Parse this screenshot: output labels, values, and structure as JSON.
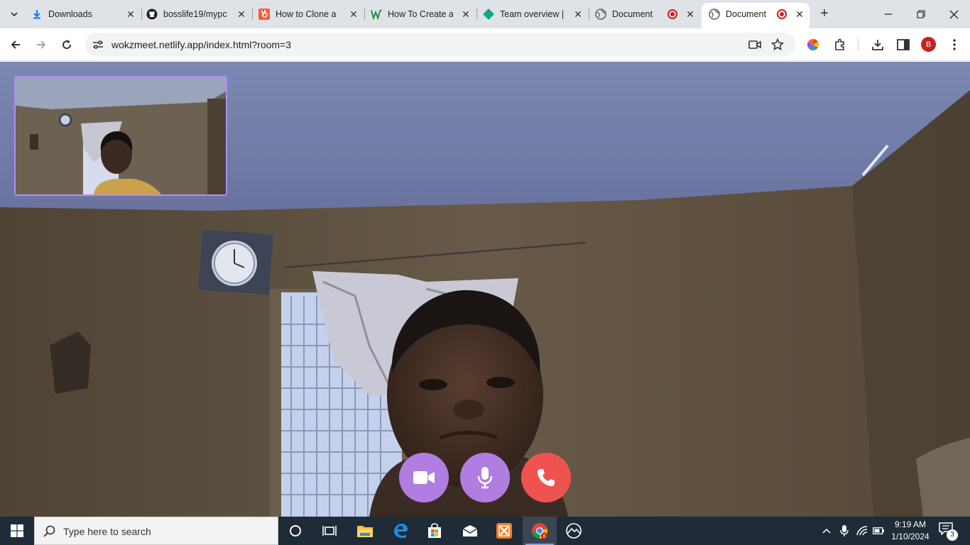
{
  "browser": {
    "tabs": [
      {
        "title": "Downloads",
        "icon": "download-icon",
        "active": false,
        "recording": false
      },
      {
        "title": "bosslife19/mypc",
        "icon": "github-icon",
        "active": false,
        "recording": false
      },
      {
        "title": "How to Clone a",
        "icon": "hubspot-icon",
        "active": false,
        "recording": false
      },
      {
        "title": "How To Create a",
        "icon": "w-icon",
        "active": false,
        "recording": false
      },
      {
        "title": "Team overview |",
        "icon": "diamond-icon",
        "active": false,
        "recording": false
      },
      {
        "title": "Document",
        "icon": "globe-icon",
        "active": false,
        "recording": true
      },
      {
        "title": "Document",
        "icon": "globe-icon",
        "active": true,
        "recording": true
      }
    ],
    "url": "wokzmeet.netlify.app/index.html?room=3",
    "profile_initial": "B"
  },
  "call": {
    "controls": [
      {
        "name": "video",
        "icon": "video-camera-icon",
        "color": "#b07de0"
      },
      {
        "name": "mic",
        "icon": "microphone-icon",
        "color": "#b07de0"
      },
      {
        "name": "end",
        "icon": "phone-icon",
        "color": "#ef5350"
      }
    ],
    "self_view_border": "#b48aff"
  },
  "taskbar": {
    "search_placeholder": "Type here to search",
    "time": "9:19 AM",
    "date": "1/10/2024",
    "notification_count": "3"
  }
}
